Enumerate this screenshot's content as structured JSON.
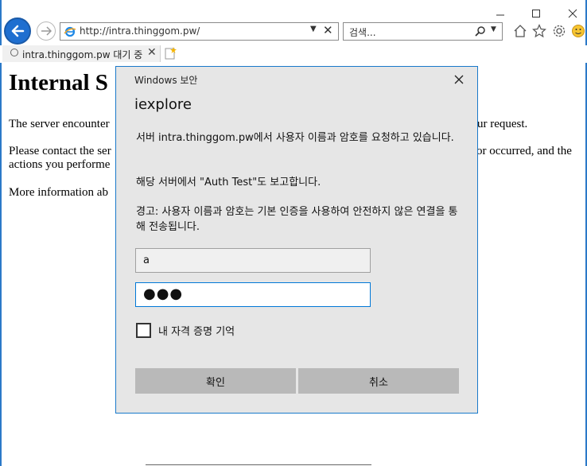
{
  "browser": {
    "address_url": "http://intra.thinggom.pw/",
    "search_placeholder": "검색...",
    "tab_title": "intra.thinggom.pw 대기 중",
    "accent_color": "#1f6fd0"
  },
  "page": {
    "heading": "Internal S",
    "para1_left": "The server encounter",
    "para1_right": "ur request.",
    "para2_left": "Please contact the ser",
    "para2_right": "or occurred, and the",
    "para2_line2": "actions you performe",
    "para3_left": "More information ab"
  },
  "dialog": {
    "title": "Windows 보안",
    "app_name": "iexplore",
    "message": "서버 intra.thinggom.pw에서 사용자 이름과 암호를 요청하고 있습니다.",
    "realm_message": "해당 서버에서 \"Auth Test\"도 보고합니다.",
    "warning": "경고: 사용자 이름과 암호는 기본 인증을 사용하여 안전하지 않은 연결을 통해 전송됩니다.",
    "username_value": "a",
    "password_value": "●●●",
    "remember_label": "내 자격 증명 기억",
    "ok_label": "확인",
    "cancel_label": "취소"
  }
}
